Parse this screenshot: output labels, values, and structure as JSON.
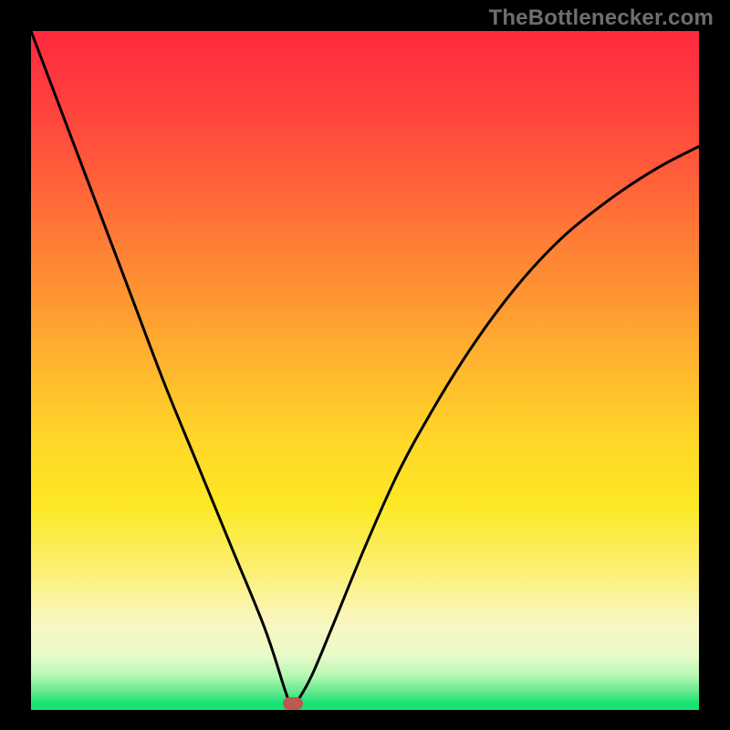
{
  "watermark": {
    "text": "TheBottlenecker.com"
  },
  "chart_data": {
    "type": "line",
    "title": "",
    "xlabel": "",
    "ylabel": "",
    "xlim": [
      0,
      100
    ],
    "ylim": [
      0,
      100
    ],
    "notes": "V-shaped bottleneck curve over red→green vertical gradient; minimum near x≈39; values are percent of plot height (0 = bottom).",
    "background_gradient_stops": [
      {
        "pct": 0,
        "color": "#ff2a3e"
      },
      {
        "pct": 50,
        "color": "#ffd628"
      },
      {
        "pct": 95,
        "color": "#b4f7b4"
      },
      {
        "pct": 100,
        "color": "#18e376"
      }
    ],
    "series": [
      {
        "name": "bottleneck-curve",
        "x": [
          0,
          5,
          10,
          15,
          20,
          25,
          30,
          35,
          38,
          39,
          40,
          42,
          45,
          50,
          55,
          60,
          65,
          70,
          75,
          80,
          85,
          90,
          95,
          100
        ],
        "y": [
          100,
          87,
          74,
          61,
          48,
          36,
          24,
          12,
          3,
          0.5,
          1.5,
          5,
          12,
          24,
          35,
          44,
          52,
          59,
          65,
          70,
          74,
          77.5,
          80.5,
          83
        ]
      }
    ],
    "marker": {
      "x_pct": 39.2,
      "y_from_bottom_pct": 0.5,
      "color": "#b95a52"
    }
  }
}
